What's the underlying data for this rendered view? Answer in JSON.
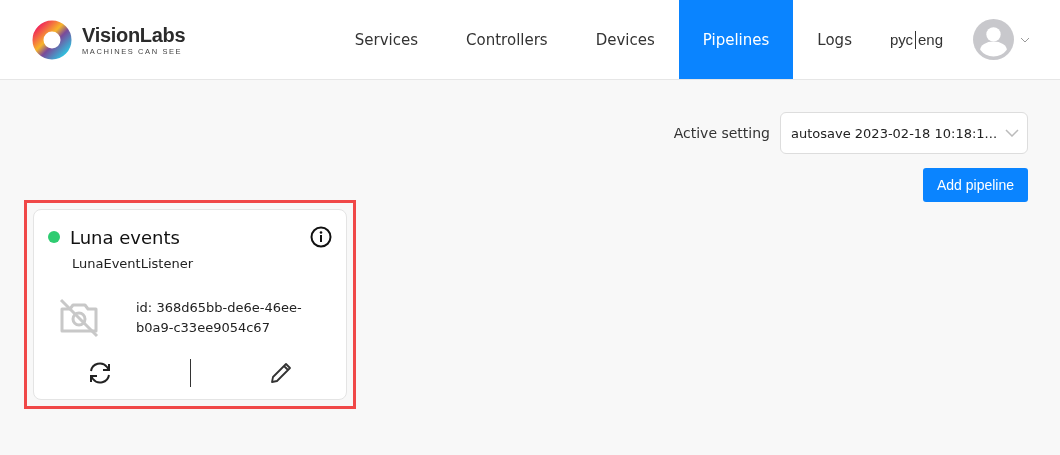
{
  "logo": {
    "name": "VisionLabs",
    "tagline": "MACHINES CAN SEE"
  },
  "nav": [
    {
      "label": "Services",
      "selected": false
    },
    {
      "label": "Controllers",
      "selected": false
    },
    {
      "label": "Devices",
      "selected": false
    },
    {
      "label": "Pipelines",
      "selected": true
    },
    {
      "label": "Logs",
      "selected": false
    }
  ],
  "languages": [
    "рус",
    "eng"
  ],
  "active_setting": {
    "label": "Active setting",
    "value": "autosave 2023-02-18 10:18:1..."
  },
  "add_button": "Add pipeline",
  "pipelines": [
    {
      "title": "Luna events",
      "subtitle": "LunaEventListener",
      "color": "#2ecc71",
      "id": "id: 368d65bb-de6e-46ee-b0a9-c33ee9054c67",
      "highlighted": true
    }
  ]
}
